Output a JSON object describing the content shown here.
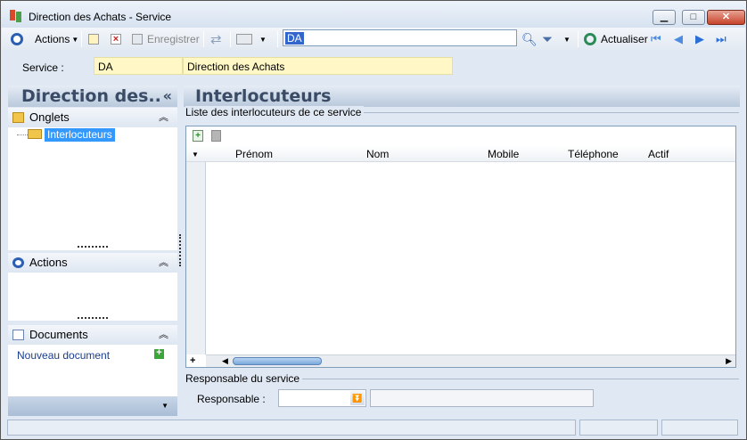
{
  "window": {
    "title": "Direction des Achats -  Service",
    "minimize": "▁",
    "maximize": "□",
    "close": "✕"
  },
  "toolbar": {
    "actions_label": "Actions",
    "save_label": "Enregistrer",
    "selection_value": "DA",
    "refresh_label": "Actualiser"
  },
  "service": {
    "label": "Service :",
    "code": "DA",
    "name": "Direction des Achats"
  },
  "left": {
    "header": "Direction des..",
    "collapse": "«",
    "onglets_title": "Onglets",
    "tree_item": "Interlocuteurs",
    "actions_title": "Actions",
    "documents_title": "Documents",
    "new_document": "Nouveau document",
    "chevron": "⌃"
  },
  "main": {
    "header": "Interlocuteurs",
    "list_group": "Liste des interlocuteurs de ce service",
    "columns": [
      "Prénom",
      "Nom",
      "Mobile",
      "Téléphone",
      "Actif"
    ],
    "resp_group": "Responsable du service",
    "resp_label": "Responsable :"
  }
}
